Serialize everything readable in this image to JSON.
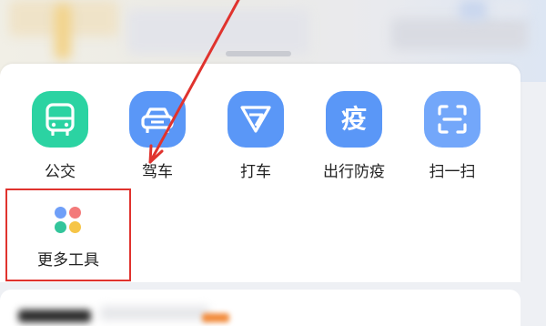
{
  "toolbar": {
    "items": [
      {
        "label": "公交",
        "icon": "bus-icon",
        "color": "#2bd3a2"
      },
      {
        "label": "驾车",
        "icon": "car-icon",
        "color": "#5a97f7"
      },
      {
        "label": "打车",
        "icon": "taxi-icon",
        "color": "#5a97f7"
      },
      {
        "label": "出行防疫",
        "icon": "epidemic-icon",
        "glyph": "疫",
        "color": "#5a97f7"
      },
      {
        "label": "扫一扫",
        "icon": "scan-icon",
        "color": "#73a7fa"
      }
    ]
  },
  "more_tools": {
    "label": "更多工具",
    "icon": "grid-dots-icon",
    "highlight_color": "#e0332e"
  },
  "annotation": {
    "arrow_color": "#e0332e"
  }
}
